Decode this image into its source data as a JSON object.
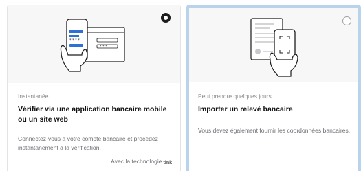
{
  "options": [
    {
      "eyebrow": "Instantanée",
      "title": "Vérifier via une application bancaire mobile ou un site web",
      "description": "Connectez-vous à votre compte bancaire et procédez instantanément à la vérification.",
      "powered_by": "Avec la technologie",
      "powered_logo": "tink",
      "illustration": "phone-and-browser-login-icon",
      "selected": true
    },
    {
      "eyebrow": "Peut prendre quelques jours",
      "title": "Importer un relevé bancaire",
      "description": "Vous devez également fournir les coordonnées bancaires.",
      "illustration": "phone-scanning-document-icon",
      "selected": false
    }
  ],
  "colors": {
    "focus_ring": "#b9d3ea",
    "accent_blue": "#2f6fd6",
    "panel_gray": "#f7f7f8"
  }
}
